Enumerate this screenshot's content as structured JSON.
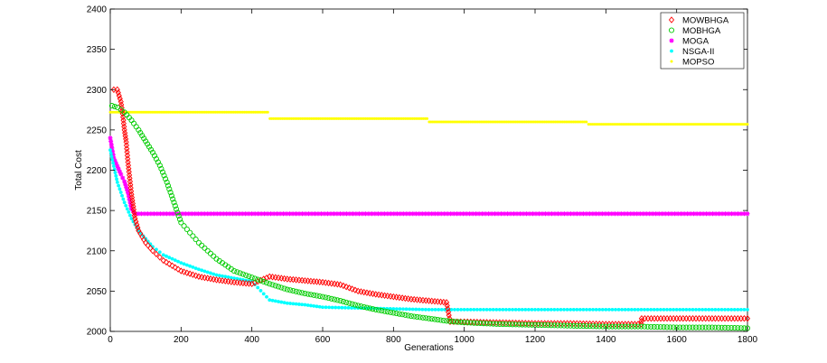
{
  "chart_data": {
    "type": "scatter",
    "title": "",
    "xlabel": "Generations",
    "ylabel": "Total Cost",
    "xlim": [
      0,
      1800
    ],
    "ylim": [
      2000,
      2400
    ],
    "xticks": [
      0,
      200,
      400,
      600,
      800,
      1000,
      1200,
      1400,
      1600,
      1800
    ],
    "yticks": [
      2000,
      2050,
      2100,
      2150,
      2200,
      2250,
      2300,
      2350,
      2400
    ],
    "grid": false,
    "legend_position": "top-right",
    "series": [
      {
        "name": "MOWBHGA",
        "color": "#ff0000",
        "marker": "diamond",
        "x": [
          10,
          20,
          30,
          35,
          40,
          45,
          50,
          55,
          60,
          70,
          80,
          100,
          120,
          150,
          200,
          250,
          300,
          350,
          400,
          450,
          500,
          550,
          600,
          650,
          700,
          750,
          800,
          850,
          900,
          950,
          960,
          1000,
          1100,
          1200,
          1300,
          1400,
          1500,
          1501,
          1600,
          1700,
          1800
        ],
        "y": [
          2300,
          2300,
          2285,
          2270,
          2250,
          2235,
          2210,
          2190,
          2170,
          2140,
          2125,
          2110,
          2100,
          2088,
          2075,
          2068,
          2064,
          2061,
          2059,
          2068,
          2065,
          2063,
          2061,
          2058,
          2050,
          2046,
          2043,
          2040,
          2038,
          2036,
          2012,
          2012,
          2011,
          2010,
          2010,
          2009,
          2009,
          2016,
          2016,
          2016,
          2016
        ]
      },
      {
        "name": "MOBHGA",
        "color": "#00cc00",
        "marker": "circle",
        "x": [
          5,
          20,
          40,
          60,
          80,
          100,
          120,
          140,
          160,
          180,
          200,
          250,
          300,
          350,
          400,
          450,
          500,
          550,
          600,
          650,
          700,
          750,
          800,
          850,
          900,
          950,
          1000,
          1100,
          1200,
          1300,
          1400,
          1500,
          1600,
          1700,
          1800
        ],
        "y": [
          2280,
          2278,
          2272,
          2262,
          2250,
          2236,
          2222,
          2206,
          2185,
          2160,
          2135,
          2110,
          2090,
          2075,
          2067,
          2059,
          2052,
          2047,
          2043,
          2038,
          2032,
          2027,
          2023,
          2019,
          2016,
          2013,
          2011,
          2009,
          2008,
          2007,
          2006,
          2006,
          2005,
          2005,
          2004
        ]
      },
      {
        "name": "MOGA",
        "color": "#ff00ff",
        "marker": "star",
        "x": [
          0,
          10,
          20,
          30,
          40,
          50,
          60,
          70,
          1800
        ],
        "y": [
          2240,
          2215,
          2205,
          2195,
          2186,
          2172,
          2152,
          2146,
          2146
        ]
      },
      {
        "name": "NSGA-II",
        "color": "#00ffff",
        "marker": "dot",
        "x": [
          0,
          20,
          40,
          60,
          80,
          100,
          120,
          150,
          200,
          250,
          300,
          350,
          400,
          450,
          500,
          550,
          600,
          700,
          800,
          900,
          1000,
          1100,
          1200,
          1300,
          1400,
          1500,
          1600,
          1700,
          1800
        ],
        "y": [
          2225,
          2185,
          2160,
          2140,
          2125,
          2115,
          2105,
          2095,
          2085,
          2077,
          2070,
          2066,
          2062,
          2039,
          2035,
          2033,
          2030,
          2029,
          2028,
          2027,
          2027,
          2027,
          2027,
          2027,
          2027,
          2027,
          2027,
          2027,
          2027
        ]
      },
      {
        "name": "MOPSO",
        "color": "#ffff00",
        "marker": "point",
        "x": [
          0,
          450,
          451,
          900,
          901,
          1350,
          1351,
          1800
        ],
        "y": [
          2272,
          2272,
          2264,
          2264,
          2260,
          2260,
          2257,
          2257
        ]
      }
    ]
  }
}
